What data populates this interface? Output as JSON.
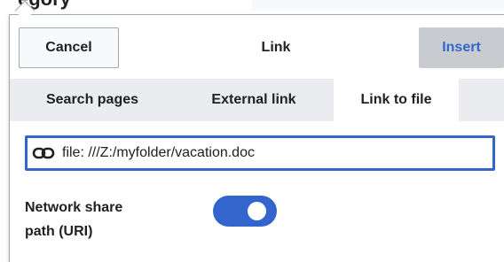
{
  "background": {
    "partial_heading": "egory"
  },
  "dialog": {
    "title": "Link",
    "cancel_label": "Cancel",
    "insert_label": "Insert",
    "tabs": [
      {
        "label": "Search pages",
        "selected": false
      },
      {
        "label": "External link",
        "selected": false
      },
      {
        "label": "Link to file",
        "selected": true
      }
    ],
    "link_input": {
      "value": "file: ///Z:/myfolder/vacation.doc",
      "icon": "link-icon"
    },
    "network_share": {
      "label_line1": "Network share",
      "label_line2": "path (URI)",
      "enabled": true
    }
  },
  "colors": {
    "accent": "#3366cc",
    "tabbar_bg": "#eaecf0",
    "disabled_button_bg": "#c8ccd1",
    "border": "#a2a9b1"
  }
}
